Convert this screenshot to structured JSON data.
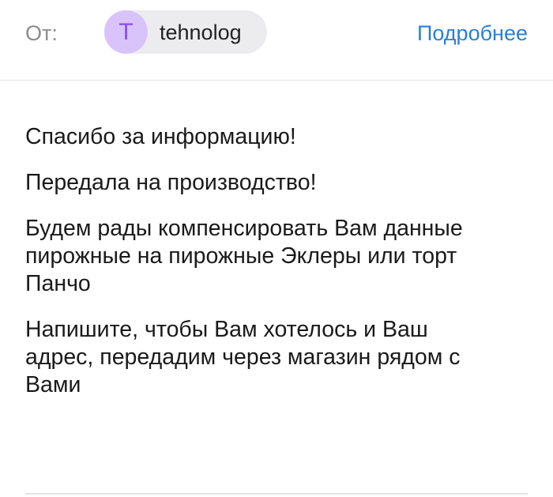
{
  "header": {
    "from_label": "От:",
    "sender": {
      "initial": "T",
      "name": "tehnolog"
    },
    "details_link": "Подробнее"
  },
  "message": {
    "paragraphs": [
      "Спасибо за информацию!",
      "Передала на производство!",
      "Будем рады компенсировать Вам данные\nпирожные на пирожные Эклеры или торт\nПанчо",
      "Напишите, чтобы Вам хотелось и Ваш\nадрес, передадим через магазин рядом с\nВами"
    ]
  },
  "colors": {
    "link": "#2a7fd3",
    "avatar_bg": "#d9c3fb",
    "avatar_fg": "#8a4ff0",
    "chip_bg": "#ececef"
  }
}
